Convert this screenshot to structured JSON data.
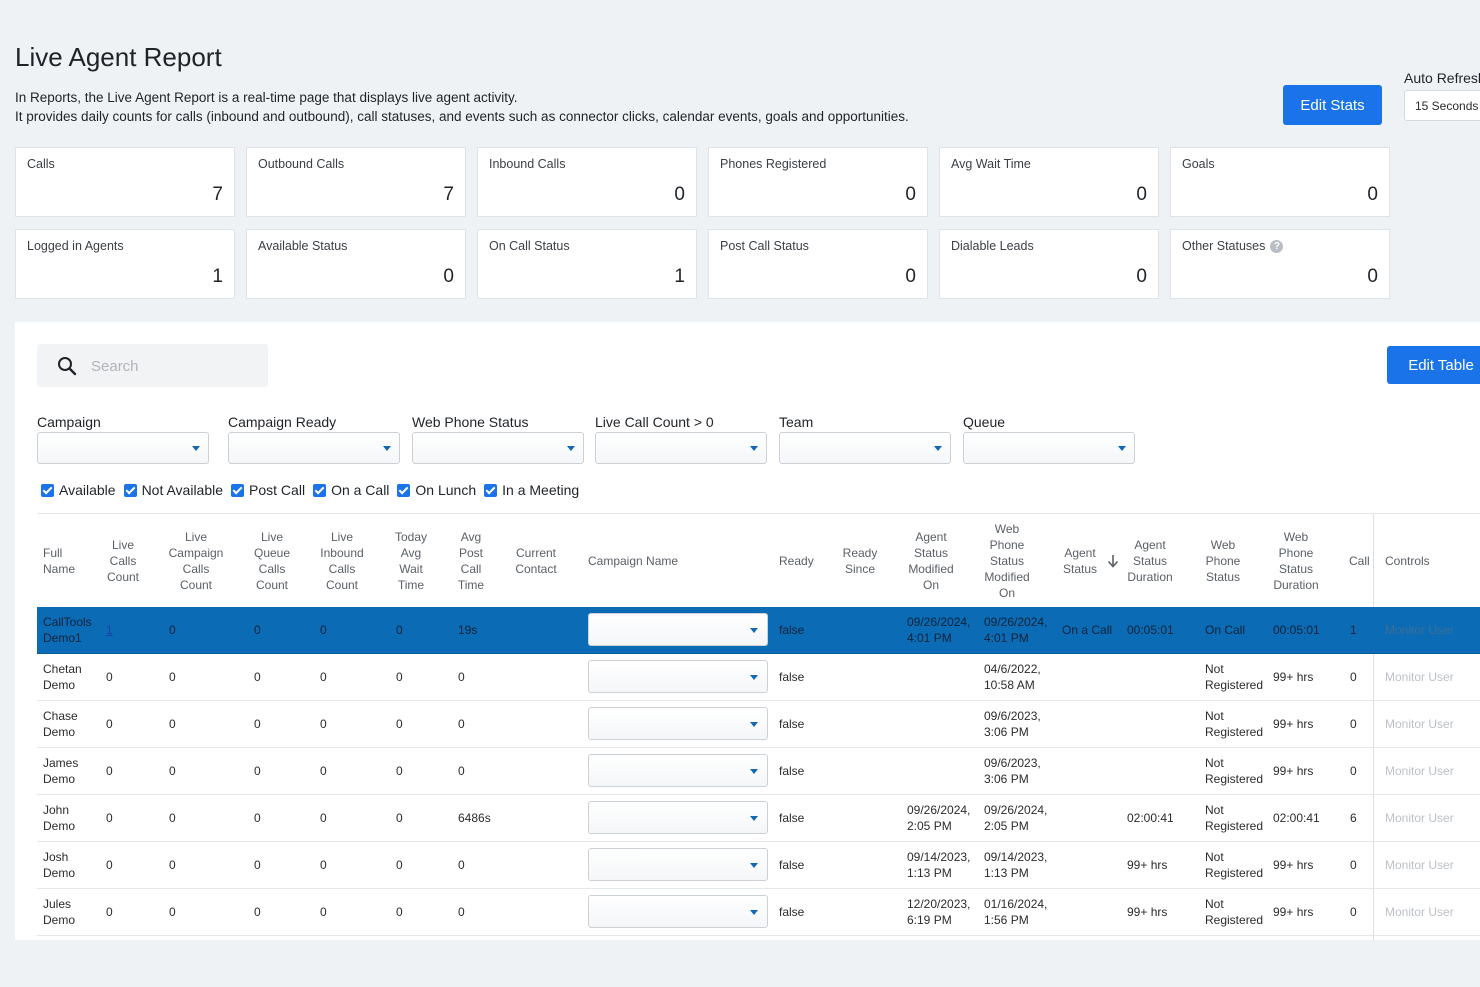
{
  "header": {
    "title": "Live Agent Report",
    "desc_line1": "In Reports, the Live Agent Report is a real-time page that displays live agent activity.",
    "desc_line2": "It provides daily counts for calls (inbound and outbound), call statuses, and events such as connector clicks, calendar events, goals and opportunities.",
    "edit_stats_label": "Edit Stats",
    "auto_refresh_label": "Auto Refresh",
    "auto_refresh_value": "15 Seconds"
  },
  "stats": [
    {
      "label": "Calls",
      "value": "7"
    },
    {
      "label": "Outbound Calls",
      "value": "7"
    },
    {
      "label": "Inbound Calls",
      "value": "0"
    },
    {
      "label": "Phones Registered",
      "value": "0"
    },
    {
      "label": "Avg Wait Time",
      "value": "0"
    },
    {
      "label": "Goals",
      "value": "0"
    },
    {
      "label": "Logged in Agents",
      "value": "1"
    },
    {
      "label": "Available Status",
      "value": "0"
    },
    {
      "label": "On Call Status",
      "value": "1"
    },
    {
      "label": "Post Call Status",
      "value": "0"
    },
    {
      "label": "Dialable Leads",
      "value": "0"
    },
    {
      "label": "Other Statuses",
      "value": "0",
      "help_icon": "question-circle-icon"
    }
  ],
  "toolbar": {
    "search_placeholder": "Search",
    "edit_table_label": "Edit Table"
  },
  "filters": [
    {
      "label": "Campaign",
      "value": ""
    },
    {
      "label": "Campaign Ready",
      "value": ""
    },
    {
      "label": "Web Phone Status",
      "value": ""
    },
    {
      "label": "Live Call Count > 0",
      "value": ""
    },
    {
      "label": "Team",
      "value": ""
    },
    {
      "label": "Queue",
      "value": ""
    }
  ],
  "status_checks": [
    {
      "label": "Available",
      "checked": true
    },
    {
      "label": "Not Available",
      "checked": true
    },
    {
      "label": "Post Call",
      "checked": true
    },
    {
      "label": "On a Call",
      "checked": true
    },
    {
      "label": "On Lunch",
      "checked": true
    },
    {
      "label": "In a Meeting",
      "checked": true
    }
  ],
  "table": {
    "headers": [
      "Full Name",
      "Live Calls Count",
      "Live Campaign Calls Count",
      "Live Queue Calls Count",
      "Live Inbound Calls Count",
      "Today Avg Wait Time",
      "Avg Post Call Time",
      "Current Contact",
      "Campaign Name",
      "Ready",
      "Ready Since",
      "Agent Status Modified On",
      "Web Phone Status Modified On",
      "Agent Status",
      "Agent Status Duration",
      "Web Phone Status",
      "Web Phone Status Duration",
      "Call",
      "Controls"
    ],
    "sort_icon": "arrow-down-icon",
    "monitor_label": "Monitor User",
    "rows": [
      {
        "name_1": "CallTools",
        "name_2": "Demo1",
        "live_calls": "1",
        "live_campaign": "0",
        "live_queue": "0",
        "live_inbound": "0",
        "avg_wait": "0",
        "avg_post": "19s",
        "current_contact": "",
        "ready": "false",
        "ready_since": "",
        "agent_mod_1": "09/26/2024,",
        "agent_mod_2": "4:01 PM",
        "web_mod_1": "09/26/2024,",
        "web_mod_2": "4:01 PM",
        "agent_status": "On a Call",
        "agent_duration": "00:05:01",
        "web_status_1": "On Call",
        "web_status_2": "",
        "web_duration": "00:05:01",
        "calls": "1",
        "selected": true
      },
      {
        "name_1": "Chetan",
        "name_2": "Demo",
        "live_calls": "0",
        "live_campaign": "0",
        "live_queue": "0",
        "live_inbound": "0",
        "avg_wait": "0",
        "avg_post": "0",
        "current_contact": "",
        "ready": "false",
        "ready_since": "",
        "agent_mod_1": "",
        "agent_mod_2": "",
        "web_mod_1": "04/6/2022,",
        "web_mod_2": "10:58 AM",
        "agent_status": "",
        "agent_duration": "",
        "web_status_1": "Not",
        "web_status_2": "Registered",
        "web_duration": "99+ hrs",
        "calls": "0",
        "selected": false
      },
      {
        "name_1": "Chase",
        "name_2": "Demo",
        "live_calls": "0",
        "live_campaign": "0",
        "live_queue": "0",
        "live_inbound": "0",
        "avg_wait": "0",
        "avg_post": "0",
        "current_contact": "",
        "ready": "false",
        "ready_since": "",
        "agent_mod_1": "",
        "agent_mod_2": "",
        "web_mod_1": "09/6/2023,",
        "web_mod_2": "3:06 PM",
        "agent_status": "",
        "agent_duration": "",
        "web_status_1": "Not",
        "web_status_2": "Registered",
        "web_duration": "99+ hrs",
        "calls": "0",
        "selected": false
      },
      {
        "name_1": "James",
        "name_2": "Demo",
        "live_calls": "0",
        "live_campaign": "0",
        "live_queue": "0",
        "live_inbound": "0",
        "avg_wait": "0",
        "avg_post": "0",
        "current_contact": "",
        "ready": "false",
        "ready_since": "",
        "agent_mod_1": "",
        "agent_mod_2": "",
        "web_mod_1": "09/6/2023,",
        "web_mod_2": "3:06 PM",
        "agent_status": "",
        "agent_duration": "",
        "web_status_1": "Not",
        "web_status_2": "Registered",
        "web_duration": "99+ hrs",
        "calls": "0",
        "selected": false
      },
      {
        "name_1": "John",
        "name_2": "Demo",
        "live_calls": "0",
        "live_campaign": "0",
        "live_queue": "0",
        "live_inbound": "0",
        "avg_wait": "0",
        "avg_post": "6486s",
        "current_contact": "",
        "ready": "false",
        "ready_since": "",
        "agent_mod_1": "09/26/2024,",
        "agent_mod_2": "2:05 PM",
        "web_mod_1": "09/26/2024,",
        "web_mod_2": "2:05 PM",
        "agent_status": "",
        "agent_duration": "02:00:41",
        "web_status_1": "Not",
        "web_status_2": "Registered",
        "web_duration": "02:00:41",
        "calls": "6",
        "selected": false
      },
      {
        "name_1": "Josh",
        "name_2": "Demo",
        "live_calls": "0",
        "live_campaign": "0",
        "live_queue": "0",
        "live_inbound": "0",
        "avg_wait": "0",
        "avg_post": "0",
        "current_contact": "",
        "ready": "false",
        "ready_since": "",
        "agent_mod_1": "09/14/2023,",
        "agent_mod_2": "1:13 PM",
        "web_mod_1": "09/14/2023,",
        "web_mod_2": "1:13 PM",
        "agent_status": "",
        "agent_duration": "99+ hrs",
        "web_status_1": "Not",
        "web_status_2": "Registered",
        "web_duration": "99+ hrs",
        "calls": "0",
        "selected": false
      },
      {
        "name_1": "Jules",
        "name_2": "Demo",
        "live_calls": "0",
        "live_campaign": "0",
        "live_queue": "0",
        "live_inbound": "0",
        "avg_wait": "0",
        "avg_post": "0",
        "current_contact": "",
        "ready": "false",
        "ready_since": "",
        "agent_mod_1": "12/20/2023,",
        "agent_mod_2": "6:19 PM",
        "web_mod_1": "01/16/2024,",
        "web_mod_2": "1:56 PM",
        "agent_status": "",
        "agent_duration": "99+ hrs",
        "web_status_1": "Not",
        "web_status_2": "Registered",
        "web_duration": "99+ hrs",
        "calls": "0",
        "selected": false
      }
    ]
  },
  "colors": {
    "primary": "#1a73e8",
    "selected_row": "#0b6cb5",
    "page_bg": "#eff2f5"
  }
}
